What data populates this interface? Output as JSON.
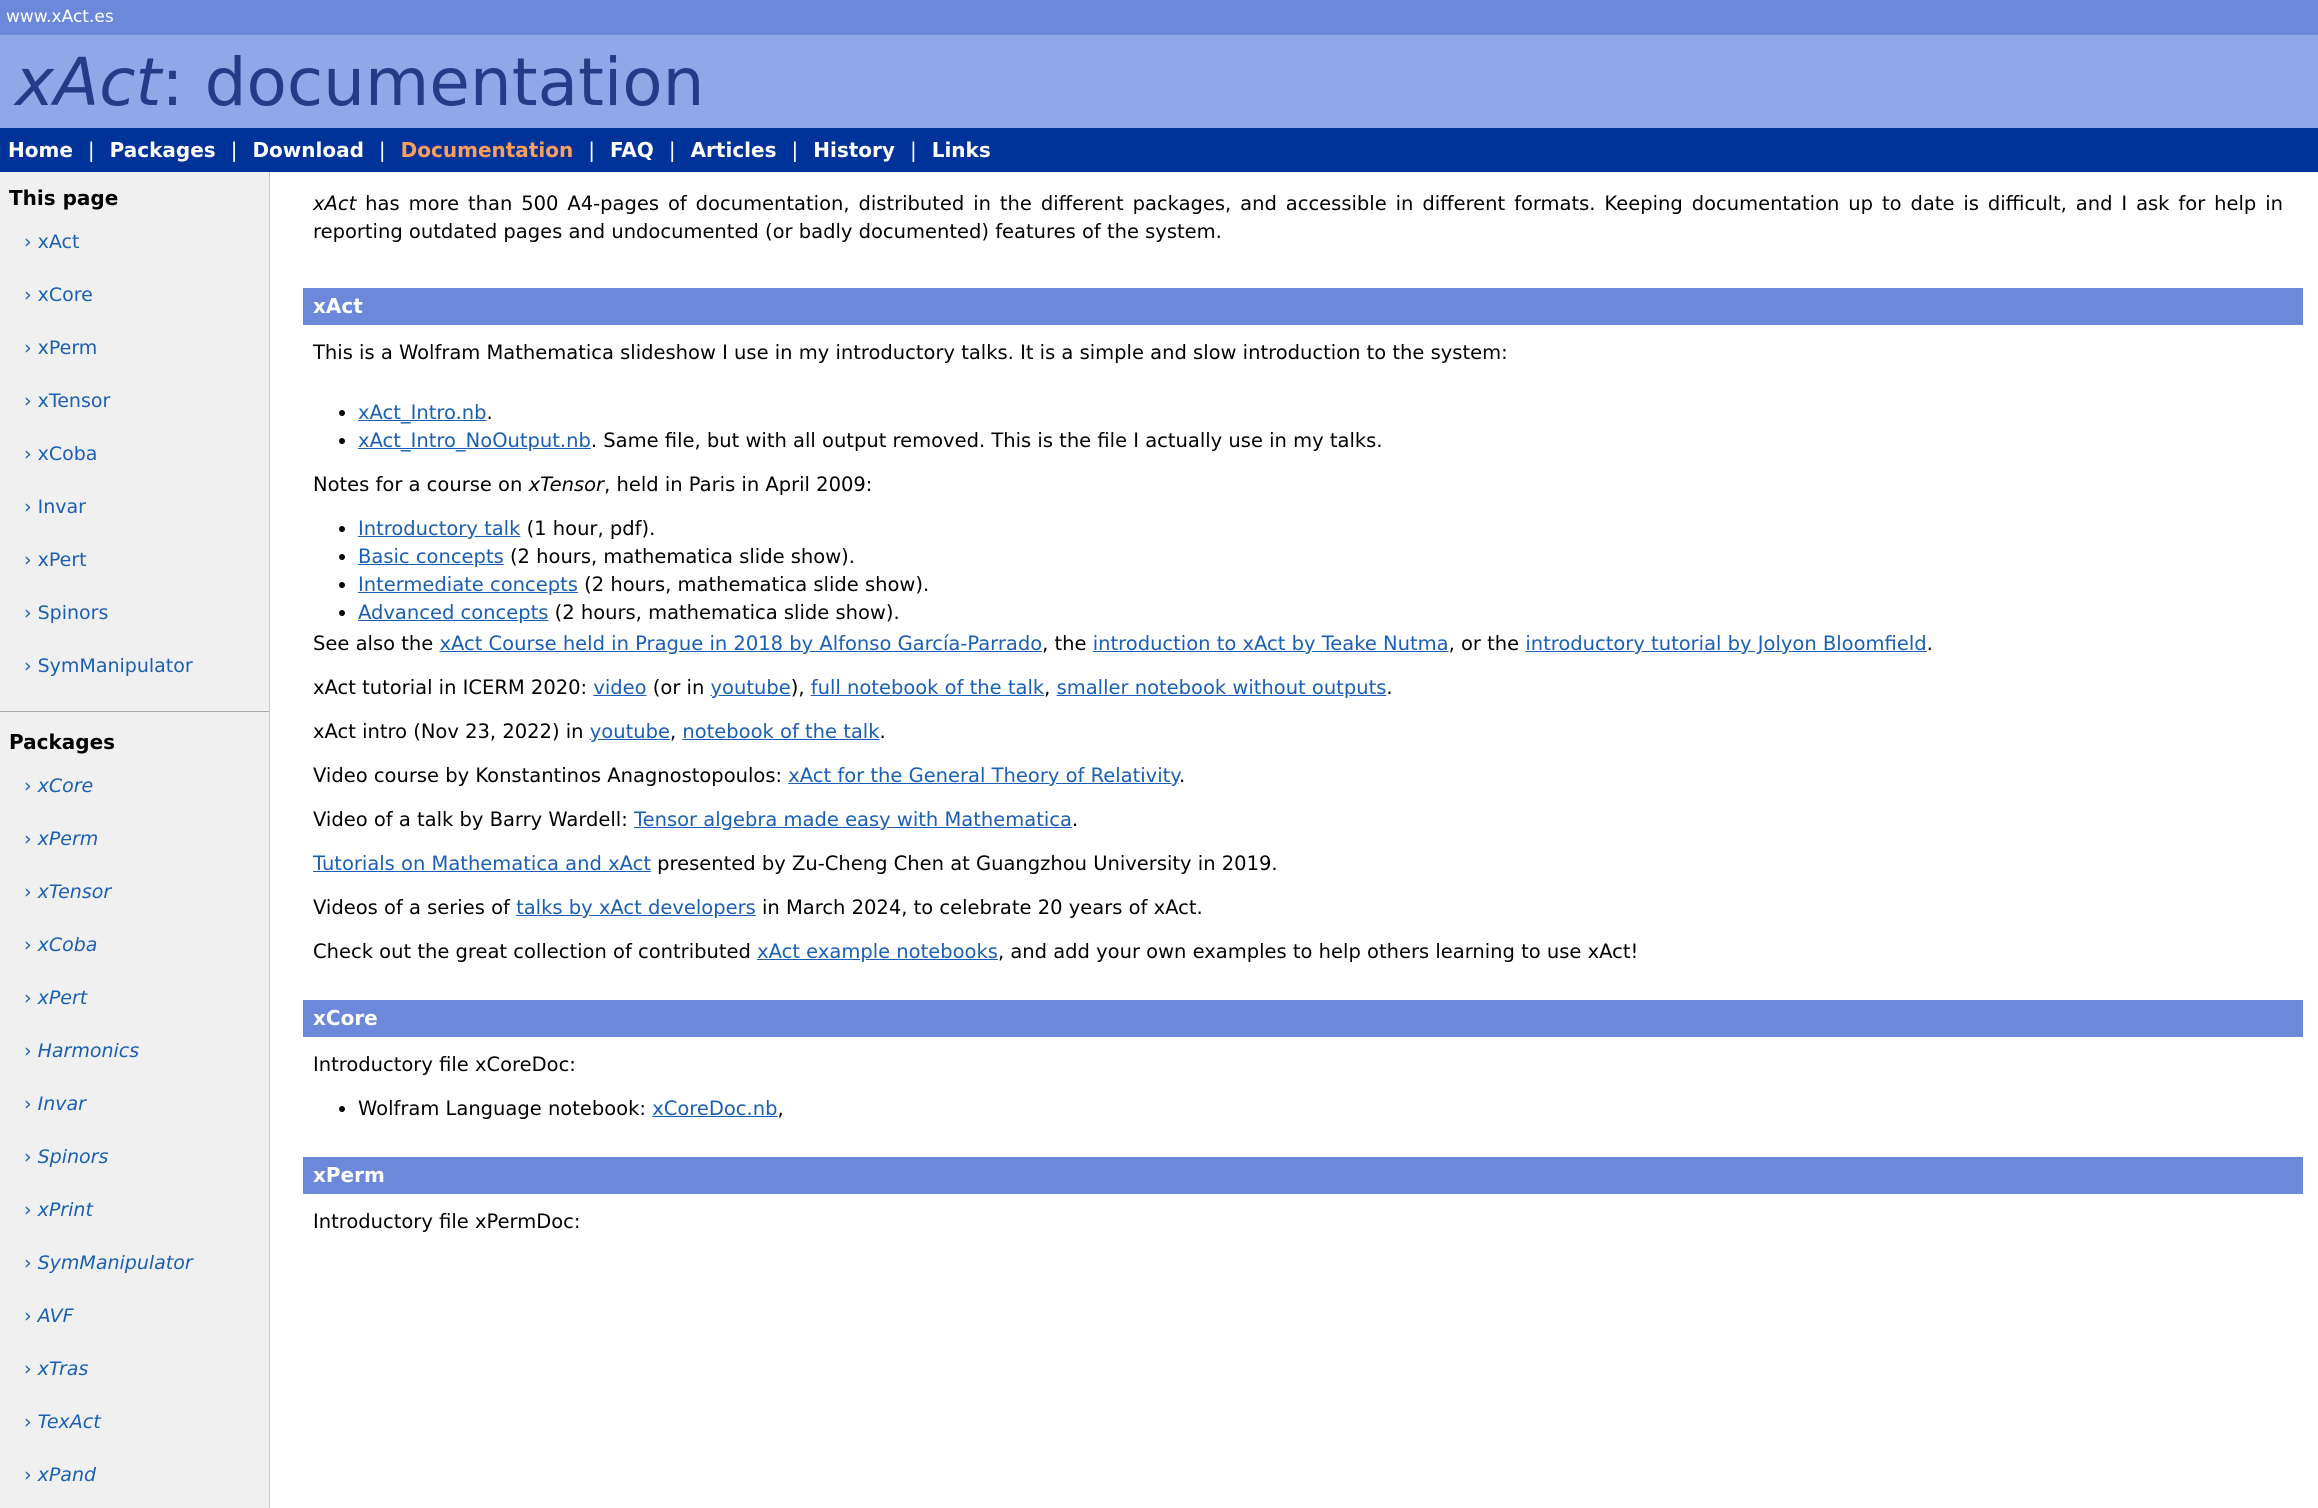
{
  "topbar": {
    "site_url": "www.xAct.es"
  },
  "header": {
    "brand": "xAct",
    "title_rest": ": documentation"
  },
  "nav": {
    "items": [
      {
        "label": "Home"
      },
      {
        "label": "Packages"
      },
      {
        "label": "Download"
      },
      {
        "label": "Documentation",
        "active": true
      },
      {
        "label": "FAQ"
      },
      {
        "label": "Articles"
      },
      {
        "label": "History"
      },
      {
        "label": "Links"
      }
    ],
    "separator": "|",
    "active_color": "#ff9e5a"
  },
  "sidebar": {
    "this_page_heading": "This page",
    "this_page_items": [
      "xAct",
      "xCore",
      "xPerm",
      "xTensor",
      "xCoba",
      "Invar",
      "xPert",
      "Spinors",
      "SymManipulator"
    ],
    "packages_heading": "Packages",
    "package_items": [
      "xCore",
      "xPerm",
      "xTensor",
      "xCoba",
      "xPert",
      "Harmonics",
      "Invar",
      "Spinors",
      "xPrint",
      "SymManipulator",
      "AVF",
      "xTras",
      "TexAct",
      "xPand"
    ],
    "chevron": "›"
  },
  "main": {
    "intro": {
      "brand": "xAct",
      "text": " has more than 500 A4-pages of documentation, distributed in the different packages, and accessible in different formats. Keeping documentation up to date is difficult, and I ask for help in reporting outdated pages and undocumented (or badly documented) features of the system."
    },
    "xact": {
      "header": "xAct",
      "slideshow_text": "This is a Wolfram Mathematica slideshow I use in my introductory talks. It is a simple and slow introduction to the system:",
      "intro_link": "xAct_Intro.nb",
      "intro_after": ".",
      "nooutput_link": "xAct_Intro_NoOutput.nb",
      "nooutput_after": ". Same file, but with all output removed. This is the file I actually use in my talks.",
      "course_before": "Notes for a course on ",
      "course_pkg": "xTensor",
      "course_after": ", held in Paris in April 2009:",
      "course_items": [
        {
          "link": "Introductory talk",
          "after": " (1 hour, pdf)."
        },
        {
          "link": "Basic concepts",
          "after": " (2 hours, mathematica slide show)."
        },
        {
          "link": "Intermediate concepts",
          "after": " (2 hours, mathematica slide show)."
        },
        {
          "link": "Advanced concepts",
          "after": " (2 hours, mathematica slide show)."
        }
      ],
      "seealso": {
        "t1": "See also the ",
        "l1": "xAct Course held in Prague in 2018 by Alfonso García-Parrado",
        "t2": ", the ",
        "l2": "introduction to xAct by Teake Nutma",
        "t3": ", or the ",
        "l3": "introductory tutorial by Jolyon Bloomfield",
        "t4": "."
      },
      "icerm": {
        "t1": "xAct tutorial in ICERM 2020: ",
        "l1": "video",
        "t2": " (or in ",
        "l2": "youtube",
        "t3": "), ",
        "l3": "full notebook of the talk",
        "t4": ", ",
        "l4": "smaller notebook without outputs",
        "t5": "."
      },
      "intro2022": {
        "t1": "xAct intro (Nov 23, 2022) in ",
        "l1": "youtube",
        "t2": ", ",
        "l2": "notebook of the talk",
        "t3": "."
      },
      "video_course": {
        "t1": "Video course by Konstantinos Anagnostopoulos: ",
        "l1": "xAct for the General Theory of Relativity",
        "t2": "."
      },
      "wardell": {
        "t1": "Video of a talk by Barry Wardell: ",
        "l1": "Tensor algebra made easy with Mathematica",
        "t2": "."
      },
      "tutorials": {
        "l1": "Tutorials on Mathematica and xAct",
        "t1": " presented by Zu-Cheng Chen at Guangzhou University in 2019."
      },
      "talks2024": {
        "t1": "Videos of a series of ",
        "l1": "talks by xAct developers",
        "t2": " in March 2024, to celebrate 20 years of xAct."
      },
      "examples": {
        "t1": "Check out the great collection of contributed ",
        "l1": "xAct example notebooks",
        "t2": ", and add your own examples to help others learning to use xAct!"
      }
    },
    "xcore": {
      "header": "xCore",
      "intro_text": "Introductory file xCoreDoc:",
      "item_text": "Wolfram Language notebook: ",
      "item_link": "xCoreDoc.nb",
      "item_after": ","
    },
    "xperm": {
      "header": "xPerm",
      "intro_text": "Introductory file xPermDoc:"
    }
  },
  "colors": {
    "topbar": "#6b88db",
    "titlebar": "#8fa9e8",
    "title_text": "#243c88",
    "navbar": "#003399",
    "section_header": "#6b88db",
    "link": "#1a5fb4",
    "sidebar_bg": "#f0f0f0"
  }
}
